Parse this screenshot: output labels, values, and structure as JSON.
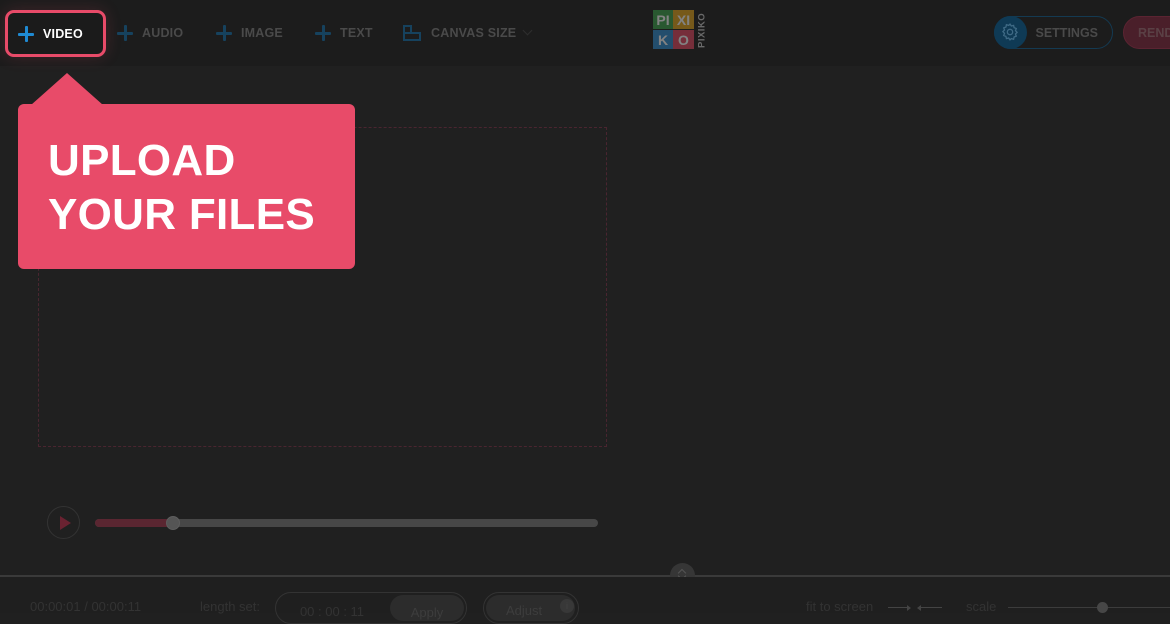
{
  "toolbar": {
    "video_label": "VIDEO",
    "audio_label": "AUDIO",
    "image_label": "IMAGE",
    "text_label": "TEXT",
    "canvas_size_label": "CANVAS SIZE",
    "settings_label": "SETTINGS",
    "render_label": "RENDER"
  },
  "logo": {
    "cells": [
      "PI",
      "XI",
      "K",
      "O"
    ],
    "vertical_text": "PIXIKO"
  },
  "tooltip": {
    "line1": "UPLOAD",
    "line2": "YOUR FILES"
  },
  "player": {
    "progress": 0.155
  },
  "bottom": {
    "time": "00:00:01 / 00:00:11",
    "length_label": "length set:",
    "length_value": "00 : 00 : 11",
    "apply_label": "Apply",
    "adjust_label": "Adjust",
    "adjust_info": "i",
    "fit_label": "fit to screen",
    "scale_label": "scale",
    "scale_value": 0.58
  },
  "colors": {
    "accent": "#e84b69",
    "blue": "#1f8ad2",
    "background": "#202020"
  },
  "icons": {
    "add": "plus-icon",
    "canvas": "canvas-size-icon",
    "settings": "gear-icon",
    "play": "play-icon",
    "resize": "resize-vertical-icon",
    "fit": "fit-to-screen-icon"
  }
}
